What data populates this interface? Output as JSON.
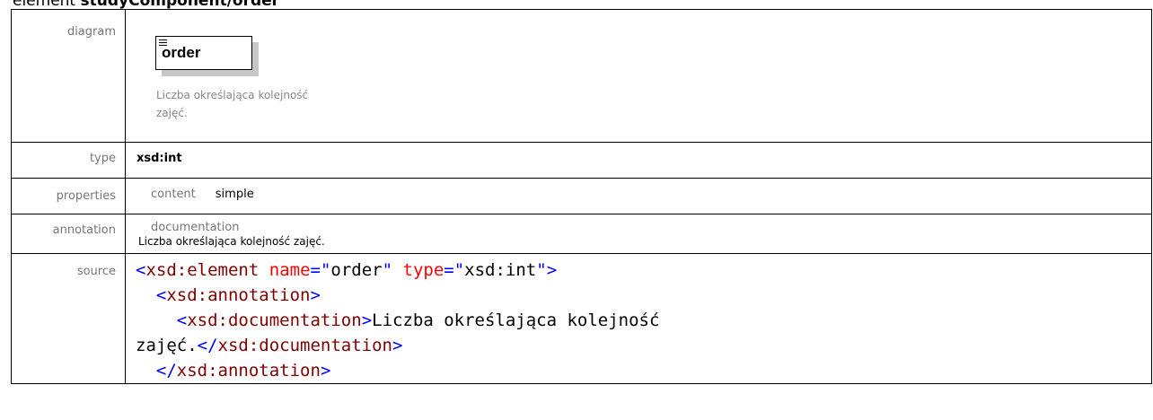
{
  "heading": {
    "prefix": "element",
    "name": "studyComponent/order"
  },
  "rows": {
    "diagram": {
      "label": "diagram",
      "element_name": "order",
      "doc_line1": "Liczba określająca kolejność",
      "doc_line2": "zajęć."
    },
    "type": {
      "label": "type",
      "value": "xsd:int"
    },
    "properties": {
      "label": "properties",
      "key": "content",
      "value": "simple"
    },
    "annotation": {
      "label": "annotation",
      "key": "documentation",
      "value": "Liczba określająca kolejność zajęć."
    },
    "source": {
      "label": "source",
      "line1": {
        "lt": "<",
        "tag": "xsd:element",
        "attr1": "name",
        "eq1": "=\"",
        "val1": "order",
        "q1": "\"",
        "attr2": "type",
        "eq2": "=\"",
        "val2": "xsd:int",
        "end": "\">"
      },
      "line2": {
        "indent": "  ",
        "lt": "<",
        "tag": "xsd:annotation",
        "gt": ">"
      },
      "line3": {
        "indent": "    ",
        "lt": "<",
        "tag": "xsd:documentation",
        "gt": ">",
        "text": "Liczba określająca kolejność"
      },
      "line4": {
        "text": "zajęć.",
        "lt": "</",
        "tag": "xsd:documentation",
        "gt": ">"
      },
      "line5": {
        "indent": "  ",
        "lt": "</",
        "tag": "xsd:annotation",
        "gt": ">"
      }
    }
  },
  "colors": {
    "label": "#777777",
    "tag": "#800000",
    "attribute": "#ff0000",
    "punctuation": "#0000ff",
    "border": "#000000"
  }
}
